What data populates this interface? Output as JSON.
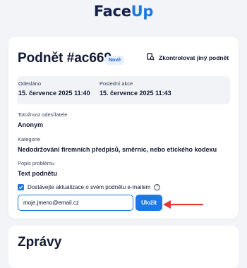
{
  "brand": {
    "logo_pre": "Face",
    "logo_accent": "Up"
  },
  "report": {
    "title": "Podnět #ac669",
    "badge": "Nové",
    "check_other_label": "Zkontrolovat jiný podnět",
    "sent_label": "Odesláno",
    "sent_value": "15. července 2025 11:40",
    "last_action_label": "Poslední akce",
    "last_action_value": "15. července 2025 11:43",
    "identity_label": "Totožnost odesílatele",
    "identity_value": "Anonym",
    "category_label": "Kategorie",
    "category_value": "Nedodržování firemních předpisů, směrnic, nebo etického kodexu",
    "description_label": "Popis problému",
    "description_value": "Text podnětu",
    "updates_checkbox_label": "Dostávejte aktualizace o svém podnětu e-mailem",
    "updates_checked": true,
    "email_value": "moje.jmeno@email.cz",
    "save_label": "Uložit"
  },
  "messages": {
    "title": "Zprávy"
  },
  "colors": {
    "accent": "#1c78e4",
    "annotation_arrow": "#e53935"
  }
}
